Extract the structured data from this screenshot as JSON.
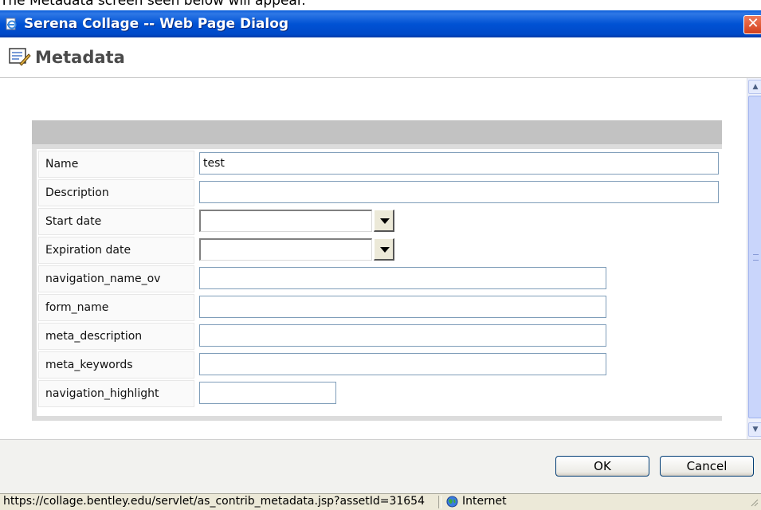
{
  "caption_text": "The Metadata screen seen below will appear.",
  "window": {
    "title": "Serena Collage -- Web Page Dialog",
    "close_label": "✕"
  },
  "header": {
    "title": "Metadata",
    "icon": "notepad-pencil-icon"
  },
  "form": {
    "fields": [
      {
        "label": "Name",
        "value": "test",
        "type": "text"
      },
      {
        "label": "Description",
        "value": "",
        "type": "text"
      },
      {
        "label": "Start date",
        "value": "",
        "type": "date"
      },
      {
        "label": "Expiration date",
        "value": "",
        "type": "date"
      },
      {
        "label": "navigation_name_ov",
        "value": "",
        "type": "text"
      },
      {
        "label": "form_name",
        "value": "",
        "type": "text"
      },
      {
        "label": "meta_description",
        "value": "",
        "type": "text"
      },
      {
        "label": "meta_keywords",
        "value": "",
        "type": "text"
      },
      {
        "label": "navigation_highlight",
        "value": "",
        "type": "text"
      }
    ]
  },
  "buttons": {
    "ok": "OK",
    "cancel": "Cancel"
  },
  "status": {
    "url": "https://collage.bentley.edu/servlet/as_contrib_metadata.jsp?assetId=31654",
    "zone": "Internet"
  }
}
